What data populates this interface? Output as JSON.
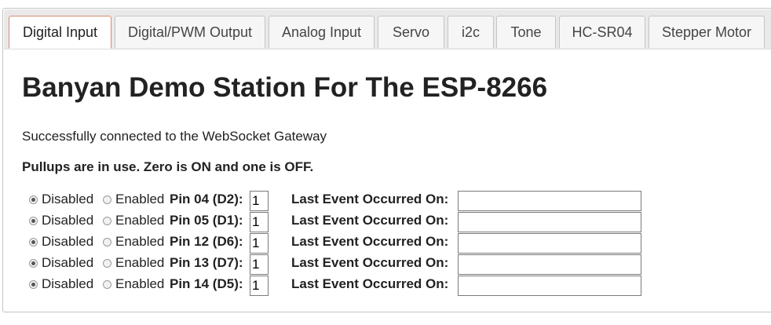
{
  "tabs": [
    {
      "label": "Digital Input",
      "active": true
    },
    {
      "label": "Digital/PWM Output",
      "active": false
    },
    {
      "label": "Analog Input",
      "active": false
    },
    {
      "label": "Servo",
      "active": false
    },
    {
      "label": "i2c",
      "active": false
    },
    {
      "label": "Tone",
      "active": false
    },
    {
      "label": "HC-SR04",
      "active": false
    },
    {
      "label": "Stepper Motor",
      "active": false
    }
  ],
  "main": {
    "title": "Banyan Demo Station For The ESP-8266",
    "status": "Successfully connected to the WebSocket Gateway",
    "pullup_note": "Pullups are in use. Zero is ON and one is OFF."
  },
  "labels": {
    "disabled": "Disabled",
    "enabled": "Enabled",
    "last_event": "Last Event Occurred On:"
  },
  "pins": [
    {
      "label": "Pin 04 (D2):",
      "value": "1",
      "selected": "disabled",
      "last_event": ""
    },
    {
      "label": "Pin 05 (D1):",
      "value": "1",
      "selected": "disabled",
      "last_event": ""
    },
    {
      "label": "Pin 12 (D6):",
      "value": "1",
      "selected": "disabled",
      "last_event": ""
    },
    {
      "label": "Pin 13 (D7):",
      "value": "1",
      "selected": "disabled",
      "last_event": ""
    },
    {
      "label": "Pin 14 (D5):",
      "value": "1",
      "selected": "disabled",
      "last_event": ""
    }
  ],
  "colors": {
    "active_tab_border": "#d98b6f",
    "tab_bar_bg": "#e9e9e9"
  }
}
